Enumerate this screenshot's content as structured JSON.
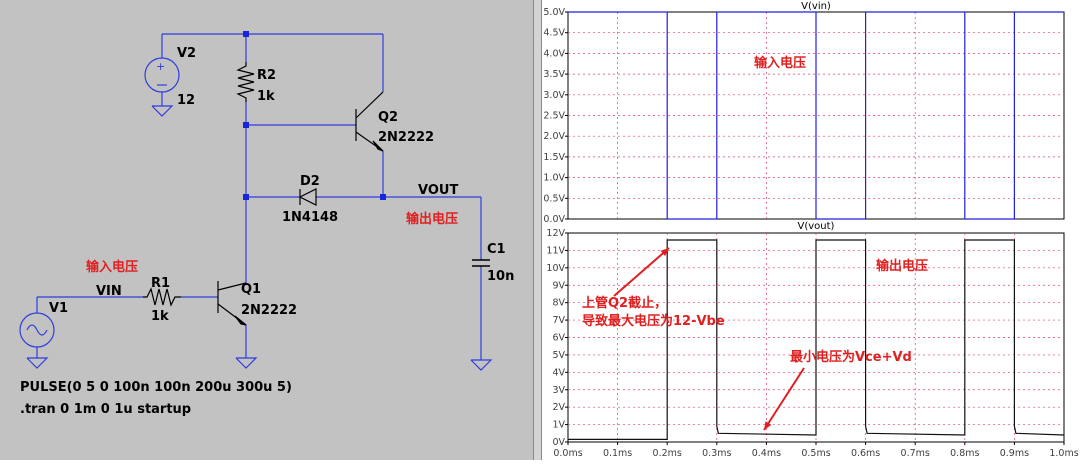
{
  "schematic": {
    "components": {
      "v2": {
        "name": "V2",
        "value": "12"
      },
      "r2": {
        "name": "R2",
        "value": "1k"
      },
      "q2": {
        "name": "Q2",
        "model": "2N2222"
      },
      "d2": {
        "name": "D2",
        "model": "1N4148"
      },
      "c1": {
        "name": "C1",
        "value": "10n"
      },
      "r1": {
        "name": "R1",
        "value": "1k"
      },
      "q1": {
        "name": "Q1",
        "model": "2N2222"
      },
      "v1": {
        "name": "V1"
      }
    },
    "nets": {
      "vout": "VOUT",
      "vin": "VIN"
    },
    "annotations": {
      "output_voltage": "输出电压",
      "input_voltage": "输入电压"
    },
    "directives": [
      "PULSE(0 5 0 100n 100n 200u 300u 5)",
      ".tran 0 1m 0 1u startup"
    ],
    "colors": {
      "wire": "#2f3cdc",
      "node": "#1a24d8",
      "background": "#c2c2c2",
      "annotation": "#e02020"
    }
  },
  "chart_data": [
    {
      "type": "line",
      "title": "V(vin)",
      "xlim": [
        0,
        1.0
      ],
      "ylim": [
        0,
        5.0
      ],
      "yticks": [
        "0.0V",
        "0.5V",
        "1.0V",
        "1.5V",
        "2.0V",
        "2.5V",
        "3.0V",
        "3.5V",
        "4.0V",
        "4.5V",
        "5.0V"
      ],
      "grid": true,
      "color": "#2222dd",
      "x": [
        0,
        0.2,
        0.2,
        0.3,
        0.3,
        0.5,
        0.5,
        0.6,
        0.6,
        0.8,
        0.8,
        0.9,
        0.9,
        1.0
      ],
      "y": [
        5,
        5,
        0,
        0,
        5,
        5,
        0,
        0,
        5,
        5,
        0,
        0,
        5,
        5
      ],
      "annotations": [
        "输入电压"
      ]
    },
    {
      "type": "line",
      "title": "V(vout)",
      "xlim": [
        0,
        1.0
      ],
      "ylim": [
        0,
        12
      ],
      "yticks": [
        "0V",
        "1V",
        "2V",
        "3V",
        "4V",
        "5V",
        "6V",
        "7V",
        "8V",
        "9V",
        "10V",
        "11V",
        "12V"
      ],
      "xticks": [
        "0.0ms",
        "0.1ms",
        "0.2ms",
        "0.3ms",
        "0.4ms",
        "0.5ms",
        "0.6ms",
        "0.7ms",
        "0.8ms",
        "0.9ms",
        "1.0ms"
      ],
      "xunit": "ms",
      "grid": true,
      "color": "#111111",
      "x": [
        0,
        0.2,
        0.2,
        0.3,
        0.3,
        0.303,
        0.5,
        0.5,
        0.6,
        0.6,
        0.603,
        0.8,
        0.8,
        0.9,
        0.9,
        0.903,
        1.0
      ],
      "y": [
        0.15,
        0.15,
        11.6,
        11.6,
        0.9,
        0.5,
        0.4,
        11.6,
        11.6,
        0.9,
        0.5,
        0.4,
        11.6,
        11.6,
        0.9,
        0.5,
        0.4
      ],
      "annotations": [
        "输出电压",
        "上管Q2截止，",
        "导致最大电压为12-Vbe",
        "最小电压为Vce+Vd"
      ]
    }
  ]
}
